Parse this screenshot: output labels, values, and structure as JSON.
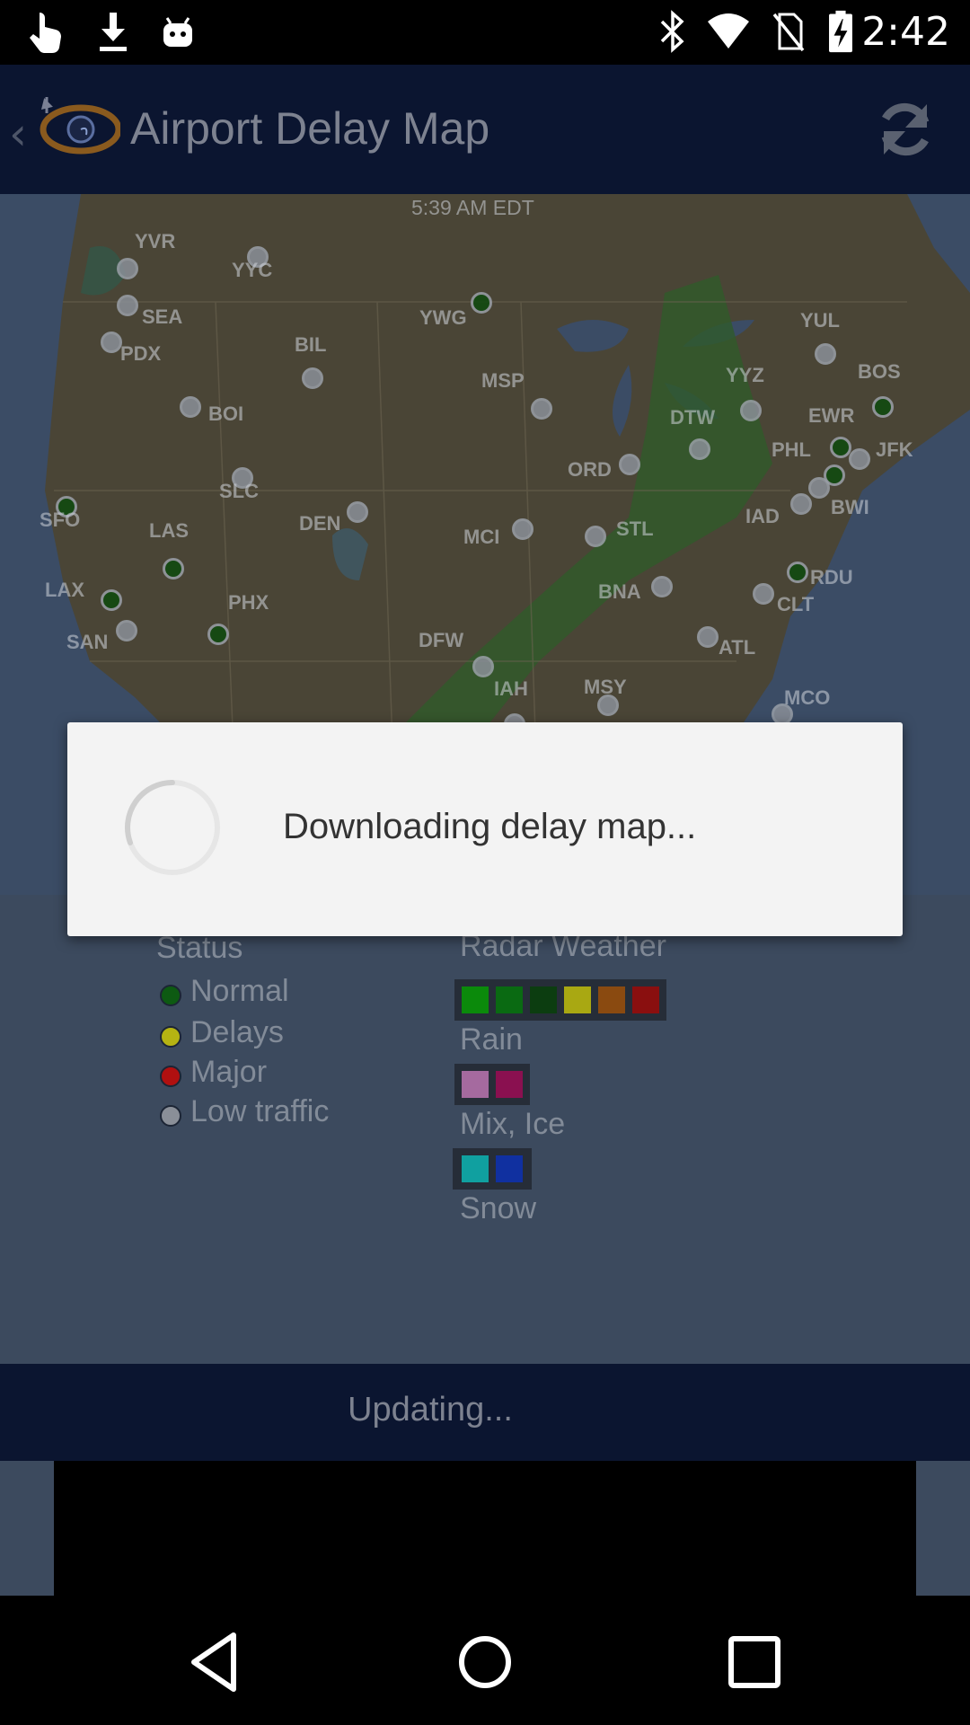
{
  "status_bar": {
    "time": "2:42",
    "left_icons": [
      "touch-icon",
      "download-icon",
      "android-icon"
    ],
    "right_icons": [
      "bluetooth-icon",
      "wifi-icon",
      "no-sim-icon",
      "battery-charging-icon"
    ]
  },
  "app_bar": {
    "title": "Airport Delay Map",
    "refresh_icon": "refresh-icon"
  },
  "map": {
    "timestamp": "5:39 AM EDT",
    "airports": [
      {
        "code": "YVR",
        "status": "low"
      },
      {
        "code": "YYC",
        "status": "low"
      },
      {
        "code": "SEA",
        "status": "low"
      },
      {
        "code": "PDX",
        "status": "low"
      },
      {
        "code": "YWG",
        "status": "normal"
      },
      {
        "code": "BIL",
        "status": "low"
      },
      {
        "code": "MSP",
        "status": "low"
      },
      {
        "code": "YUL",
        "status": "low"
      },
      {
        "code": "BOS",
        "status": "normal"
      },
      {
        "code": "YYZ",
        "status": "low"
      },
      {
        "code": "BOI",
        "status": "low"
      },
      {
        "code": "DTW",
        "status": "low"
      },
      {
        "code": "EWR",
        "status": "normal"
      },
      {
        "code": "PHL",
        "status": "normal"
      },
      {
        "code": "JFK",
        "status": "low"
      },
      {
        "code": "ORD",
        "status": "low"
      },
      {
        "code": "SLC",
        "status": "low"
      },
      {
        "code": "SFO",
        "status": "normal"
      },
      {
        "code": "BWI",
        "status": "low"
      },
      {
        "code": "IAD",
        "status": "low"
      },
      {
        "code": "LAS",
        "status": "normal"
      },
      {
        "code": "DEN",
        "status": "low"
      },
      {
        "code": "MCI",
        "status": "low"
      },
      {
        "code": "STL",
        "status": "low"
      },
      {
        "code": "RDU",
        "status": "normal"
      },
      {
        "code": "LAX",
        "status": "normal"
      },
      {
        "code": "PHX",
        "status": "normal"
      },
      {
        "code": "BNA",
        "status": "low"
      },
      {
        "code": "CLT",
        "status": "low"
      },
      {
        "code": "SAN",
        "status": "low"
      },
      {
        "code": "ATL",
        "status": "low"
      },
      {
        "code": "DFW",
        "status": "low"
      },
      {
        "code": "MSY",
        "status": "low"
      },
      {
        "code": "IAH",
        "status": "low"
      },
      {
        "code": "MCO",
        "status": "low"
      }
    ]
  },
  "legend": {
    "status_title": "Status",
    "status_items": [
      {
        "label": "Normal",
        "color": "#0d5a12"
      },
      {
        "label": "Delays",
        "color": "#b5b312"
      },
      {
        "label": "Major",
        "color": "#b01010"
      },
      {
        "label": "Low traffic",
        "color": "#8a8f98"
      }
    ],
    "radar_title": "Radar Weather",
    "radar_groups": [
      {
        "label": "Rain",
        "colors": [
          "#0b8a0b",
          "#0a6a12",
          "#0c3d10",
          "#a9a812",
          "#8a4a10",
          "#8a0f0f"
        ]
      },
      {
        "label": "Mix, Ice",
        "colors": [
          "#a56a9f",
          "#8a1050"
        ]
      },
      {
        "label": "Snow",
        "colors": [
          "#10a0a0",
          "#1030a0"
        ]
      }
    ]
  },
  "dialog": {
    "message": "Downloading delay map..."
  },
  "footer": {
    "updating_text": "Updating..."
  },
  "nav_bar": {
    "icons": [
      "back-icon",
      "home-icon",
      "recents-icon"
    ]
  }
}
